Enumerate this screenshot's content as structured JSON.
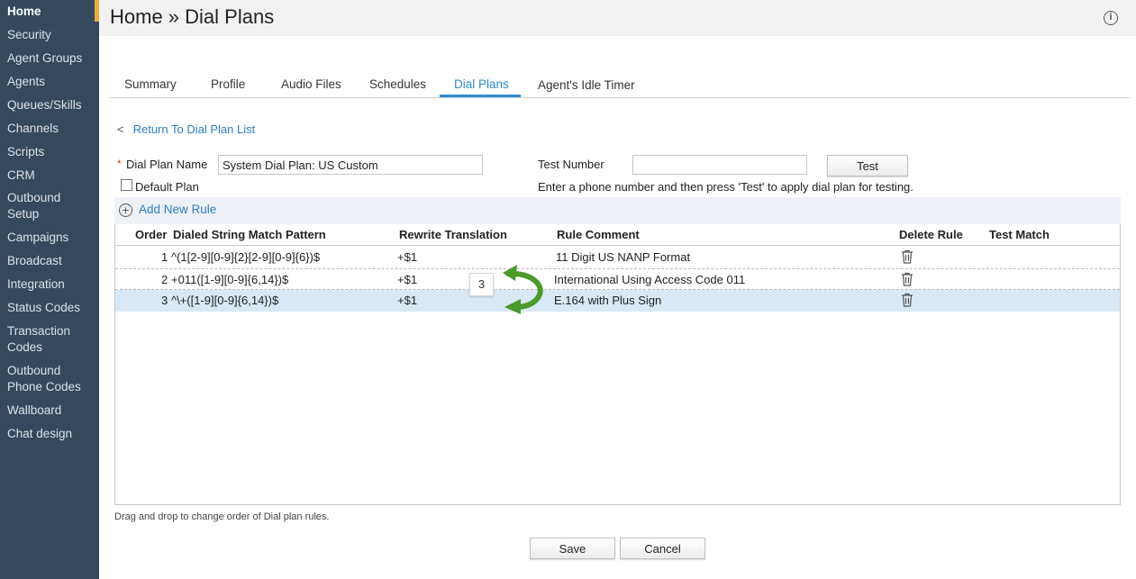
{
  "sidebar": {
    "items": [
      {
        "label": "Home"
      },
      {
        "label": "Security"
      },
      {
        "label": "Agent Groups"
      },
      {
        "label": "Agents"
      },
      {
        "label": "Queues/Skills"
      },
      {
        "label": "Channels"
      },
      {
        "label": "Scripts"
      },
      {
        "label": "CRM"
      },
      {
        "label": "Outbound",
        "label2": "Setup"
      },
      {
        "label": "Campaigns"
      },
      {
        "label": "Broadcast"
      },
      {
        "label": "Integration"
      },
      {
        "label": "Status Codes"
      },
      {
        "label": "Transaction",
        "label2": "Codes"
      },
      {
        "label": "Outbound",
        "label2": "Phone Codes"
      },
      {
        "label": "Wallboard"
      },
      {
        "label": "Chat design"
      }
    ],
    "accent_color": "#f2a93b"
  },
  "header": {
    "title": "Home » Dial Plans",
    "info_icon": "i"
  },
  "tabs": [
    {
      "label": "Summary"
    },
    {
      "label": "Profile"
    },
    {
      "label": "Audio Files"
    },
    {
      "label": "Schedules"
    },
    {
      "label": "Dial Plans",
      "active": true
    },
    {
      "label": "Agent's Idle Timer"
    }
  ],
  "back_link": {
    "chevron": "<",
    "label": "Return To Dial Plan List"
  },
  "form": {
    "required_marker": "*",
    "dial_plan_name_label": "Dial Plan Name",
    "dial_plan_name_value": "System Dial Plan: US Custom",
    "default_plan_label": "Default Plan",
    "test_number_label": "Test Number",
    "test_number_value": "",
    "test_button": "Test",
    "test_hint": "Enter a phone number and then press 'Test' to apply dial plan for testing."
  },
  "rules": {
    "add_icon": "+",
    "add_label": "Add New Rule",
    "columns": {
      "order": "Order",
      "pattern": "Dialed String Match Pattern",
      "rewrite": "Rewrite Translation",
      "comment": "Rule Comment",
      "delete": "Delete Rule",
      "test": "Test Match"
    },
    "rows": [
      {
        "order": "1",
        "pattern": "^(1[2-9][0-9]{2}[2-9][0-9]{6})$",
        "rewrite": "+$1",
        "comment": "11 Digit US NANP Format"
      },
      {
        "order": "2",
        "pattern": "+011([1-9][0-9]{6,14})$",
        "rewrite": "+$1",
        "comment": "International Using Access Code 011"
      },
      {
        "order": "3",
        "pattern": "^\\+([1-9][0-9]{6,14})$",
        "rewrite": "+$1",
        "comment": "E.164 with Plus Sign"
      }
    ],
    "drag_badge": "3",
    "hint": "Drag and drop to change order of Dial plan rules."
  },
  "footer": {
    "save": "Save",
    "cancel": "Cancel"
  },
  "colors": {
    "link": "#2e7ec0",
    "selected_row": "#d9e8f5",
    "arrow": "#4c9a2a"
  }
}
